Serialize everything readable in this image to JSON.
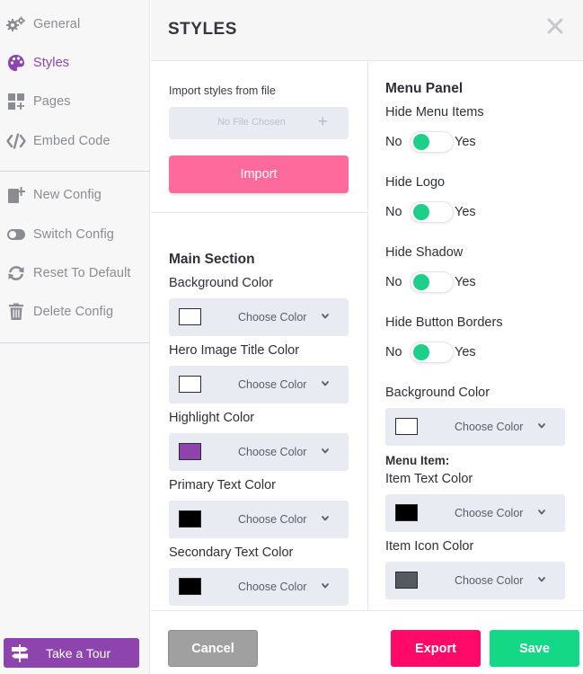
{
  "sidebar": {
    "items": [
      {
        "label": "General",
        "icon": "gears-icon"
      },
      {
        "label": "Styles",
        "icon": "palette-icon",
        "active": true
      },
      {
        "label": "Pages",
        "icon": "add-pages-icon"
      },
      {
        "label": "Embed Code",
        "icon": "code-icon"
      },
      {
        "label": "New Config",
        "icon": "new-config-icon"
      },
      {
        "label": "Switch Config",
        "icon": "toggle-switch-icon"
      },
      {
        "label": "Reset To Default",
        "icon": "sync-icon"
      },
      {
        "label": "Delete Config",
        "icon": "trash-icon"
      }
    ],
    "tour_label": "Take a Tour"
  },
  "header": {
    "title": "STYLES"
  },
  "import": {
    "label": "Import styles from file",
    "file_placeholder": "No File Chosen",
    "file_plus": "+",
    "button_label": "Import"
  },
  "main_section": {
    "title": "Main Section",
    "fields": [
      {
        "label": "Background Color",
        "value_text": "Choose Color",
        "swatch": "#ffffff"
      },
      {
        "label": "Hero Image Title Color",
        "value_text": "Choose Color",
        "swatch": "#ffffff"
      },
      {
        "label": "Highlight Color",
        "value_text": "Choose Color",
        "swatch": "#8e44ad"
      },
      {
        "label": "Primary Text Color",
        "value_text": "Choose Color",
        "swatch": "#000000"
      },
      {
        "label": "Secondary Text Color",
        "value_text": "Choose Color",
        "swatch": "#000000"
      }
    ]
  },
  "menu_panel": {
    "title": "Menu Panel",
    "toggles": [
      {
        "label": "Hide Menu Items",
        "no": "No",
        "yes": "Yes",
        "value": "No"
      },
      {
        "label": "Hide Logo",
        "no": "No",
        "yes": "Yes",
        "value": "No"
      },
      {
        "label": "Hide Shadow",
        "no": "No",
        "yes": "Yes",
        "value": "No"
      },
      {
        "label": "Hide Button Borders",
        "no": "No",
        "yes": "Yes",
        "value": "No"
      }
    ],
    "background": {
      "label": "Background Color",
      "value_text": "Choose Color",
      "swatch": "#ffffff"
    },
    "menu_item_title": "Menu Item:",
    "item_text": {
      "label": "Item Text Color",
      "value_text": "Choose Color",
      "swatch": "#000000"
    },
    "item_icon": {
      "label": "Item Icon Color",
      "value_text": "Choose Color",
      "swatch": "#555a61"
    }
  },
  "footer": {
    "cancel": "Cancel",
    "export": "Export",
    "save": "Save"
  },
  "colors": {
    "accent_purple": "#8e44ad",
    "import_pink": "#ff6a9c",
    "export_pink": "#ff0a68",
    "save_green": "#14d886",
    "toggle_green": "#1ecf8a"
  }
}
